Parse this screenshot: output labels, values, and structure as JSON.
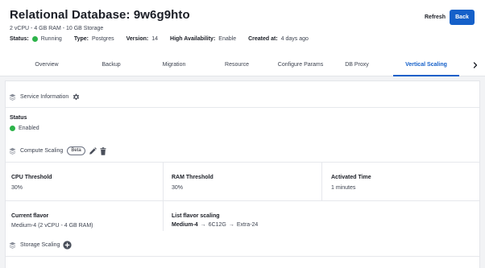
{
  "header": {
    "title": "Relational Database: 9w6g9hto",
    "subtitle": "2 vCPU - 4 GB RAM - 10 GB Storage",
    "meta": {
      "status_label": "Status:",
      "status_value": "Running",
      "type_label": "Type:",
      "type_value": "Postgres",
      "version_label": "Version:",
      "version_value": "14",
      "ha_label": "High Availability:",
      "ha_value": "Enable",
      "created_label": "Created at:",
      "created_value": "4 days ago"
    },
    "refresh_label": "Refresh",
    "back_label": "Back"
  },
  "tabs": [
    {
      "label": "Overview"
    },
    {
      "label": "Backup"
    },
    {
      "label": "Migration"
    },
    {
      "label": "Resource"
    },
    {
      "label": "Configure Params"
    },
    {
      "label": "DB Proxy"
    },
    {
      "label": "Vertical Scaling"
    }
  ],
  "active_tab": "Vertical Scaling",
  "service_info": {
    "heading": "Service Information",
    "status_label": "Status",
    "status_value": "Enabled"
  },
  "compute_scaling": {
    "heading": "Compute Scaling",
    "badge": "Beta",
    "cpu_threshold_label": "CPU Threshold",
    "cpu_threshold_value": "30%",
    "ram_threshold_label": "RAM Threshold",
    "ram_threshold_value": "30%",
    "activated_time_label": "Activated Time",
    "activated_time_value": "1 minutes",
    "current_flavor_label": "Current flavor",
    "current_flavor_value": "Medium-4 (2 vCPU - 4 GB RAM)",
    "list_flavor_label": "List flavor scaling",
    "list_flavor_items": [
      "Medium-4",
      "6C12G",
      "Extra-24"
    ],
    "arrow": "→"
  },
  "storage_scaling": {
    "heading": "Storage Scaling"
  },
  "colors": {
    "accent": "#1560c9",
    "status_green": "#2db34a"
  },
  "icons": [
    "layers-icon",
    "gear-icon",
    "pencil-icon",
    "trash-icon",
    "plus-circle-icon",
    "chevron-right-icon"
  ]
}
